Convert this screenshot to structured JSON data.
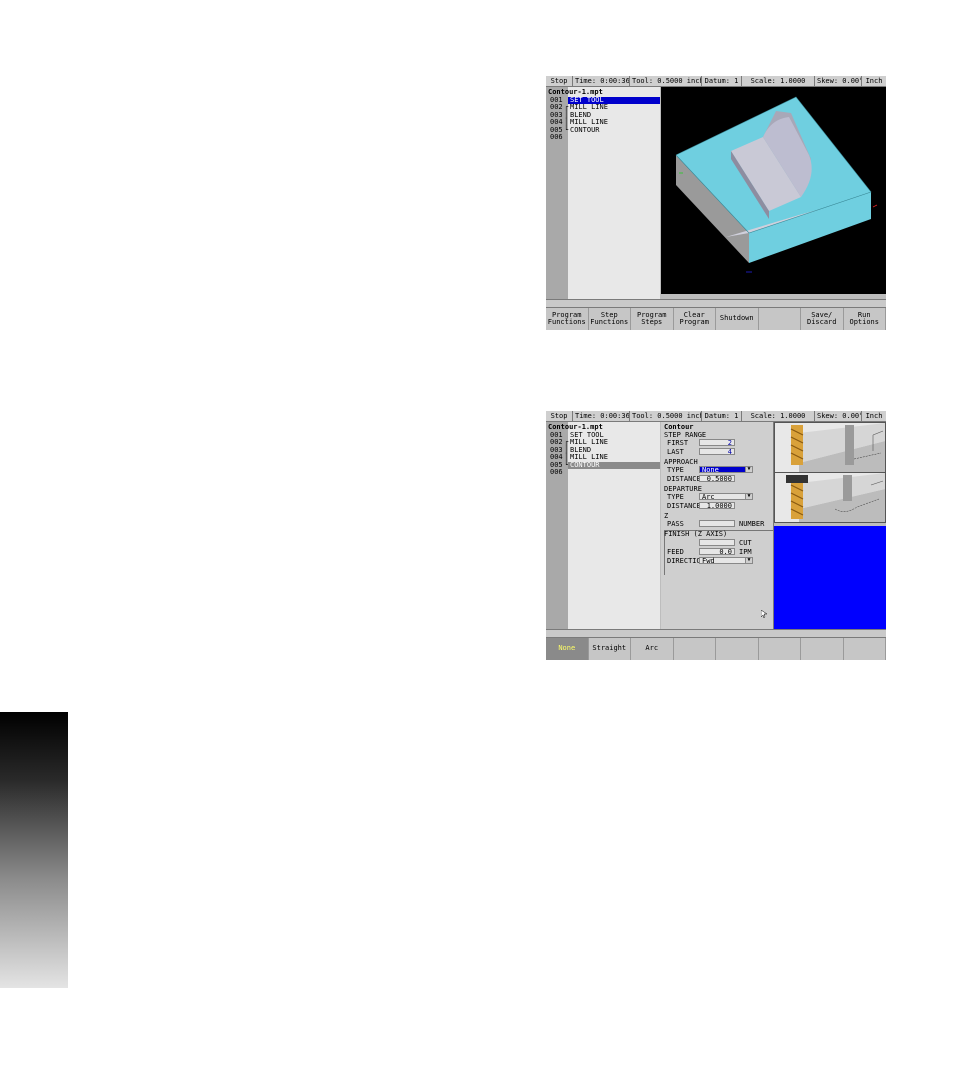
{
  "status_bar": [
    "Stop",
    "Time: 0:00:36",
    "Tool: 0.5000 inch",
    "Datum: 1",
    "Scale: 1.0000",
    "Skew: 0.00°",
    "Inch"
  ],
  "program": {
    "filename": "Contour-1.mpt",
    "steps": [
      {
        "num": "001",
        "label": "SET TOOL"
      },
      {
        "num": "002",
        "label": "MILL LINE"
      },
      {
        "num": "003",
        "label": "BLEND"
      },
      {
        "num": "004",
        "label": "MILL LINE"
      },
      {
        "num": "005",
        "label": "CONTOUR"
      },
      {
        "num": "006",
        "label": ""
      }
    ]
  },
  "screen1": {
    "selected_step": "001",
    "softkeys": [
      "Program\nFunctions",
      "Step\nFunctions",
      "Program\nSteps",
      "Clear\nProgram",
      "Shutdown",
      "",
      "Save/\nDiscard",
      "Run\nOptions"
    ]
  },
  "screen2": {
    "selected_step": "005",
    "form": {
      "title": "Contour",
      "step_range_label": "STEP RANGE",
      "first_label": "FIRST",
      "first_value": "2",
      "last_label": "LAST",
      "last_value": "4",
      "approach_label": "APPROACH",
      "approach_type_label": "TYPE",
      "approach_type_value": "None",
      "approach_distance_label": "DISTANCE",
      "approach_distance_value": "0.5000",
      "departure_label": "DEPARTURE",
      "departure_type_label": "TYPE",
      "departure_type_value": "Arc",
      "departure_distance_label": "DISTANCE",
      "departure_distance_value": "1.0000",
      "z_label": "Z",
      "pass_label": "PASS",
      "pass_value": "",
      "number_label": "NUMBER",
      "finish_label": "FINISH (Z AXIS)",
      "cut_label": "CUT",
      "cut_value": "",
      "feed_label": "FEED",
      "feed_value": "0.0",
      "ipm_label": "IPM",
      "direction_label": "DIRECTION",
      "direction_value": "Fwd"
    },
    "softkeys": [
      "None",
      "Straight",
      "Arc",
      "",
      "",
      "",
      "",
      ""
    ]
  },
  "colors": {
    "selection_blue": "#0000cc",
    "part_cyan": "#6fcfe0",
    "preview_blue": "#0000ff",
    "active_key_text": "#ffff66"
  }
}
